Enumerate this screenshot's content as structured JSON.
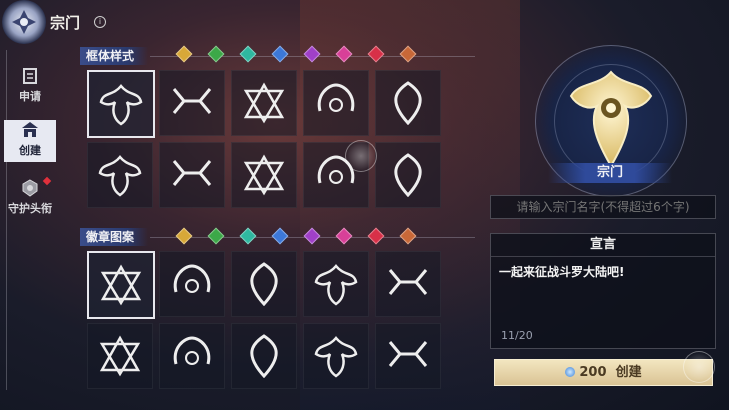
{
  "header": {
    "title": "宗门",
    "info_icon": "i"
  },
  "nav": {
    "items": [
      {
        "label": "申请",
        "icon": "apply-icon"
      },
      {
        "label": "创建",
        "icon": "create-icon",
        "active": true
      },
      {
        "label": "守护头衔",
        "icon": "guardian-icon",
        "badge": "red-dot"
      }
    ]
  },
  "frame_section": {
    "label": "框体样式"
  },
  "badge_section": {
    "label": "徽章图案"
  },
  "gem_colors": [
    "#d8a838",
    "#3ca848",
    "#2fb8a0",
    "#3c78d8",
    "#a040c8",
    "#d84098",
    "#d83048",
    "#c86838"
  ],
  "preview": {
    "name": "宗门"
  },
  "name_input": {
    "placeholder": "请输入宗门名字(不得超过6个字)"
  },
  "manifesto": {
    "title": "宣言",
    "text": "一起来征战斗罗大陆吧!",
    "counter": "11/20"
  },
  "create_button": {
    "cost": "200",
    "label": "创建"
  }
}
